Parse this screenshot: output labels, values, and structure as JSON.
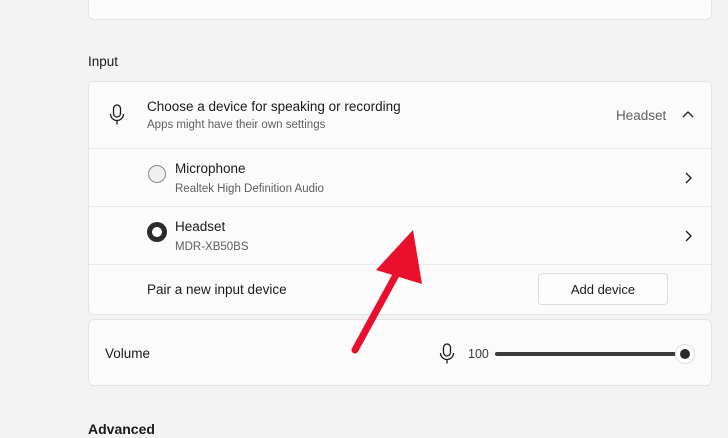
{
  "input_section": {
    "title": "Input",
    "choose_device": {
      "label": "Choose a device for speaking or recording",
      "sublabel": "Apps might have their own settings",
      "selected_value": "Headset"
    },
    "devices": [
      {
        "name": "Microphone",
        "detail": "Realtek High Definition Audio",
        "selected": false
      },
      {
        "name": "Headset",
        "detail": "MDR-XB50BS",
        "selected": true
      }
    ],
    "pair": {
      "label": "Pair a new input device",
      "button_label": "Add device"
    }
  },
  "volume": {
    "label": "Volume",
    "value": "100",
    "level_percent": 100
  },
  "advanced_section": {
    "title": "Advanced"
  },
  "annotation": {
    "arrow_color": "#e8102c"
  }
}
